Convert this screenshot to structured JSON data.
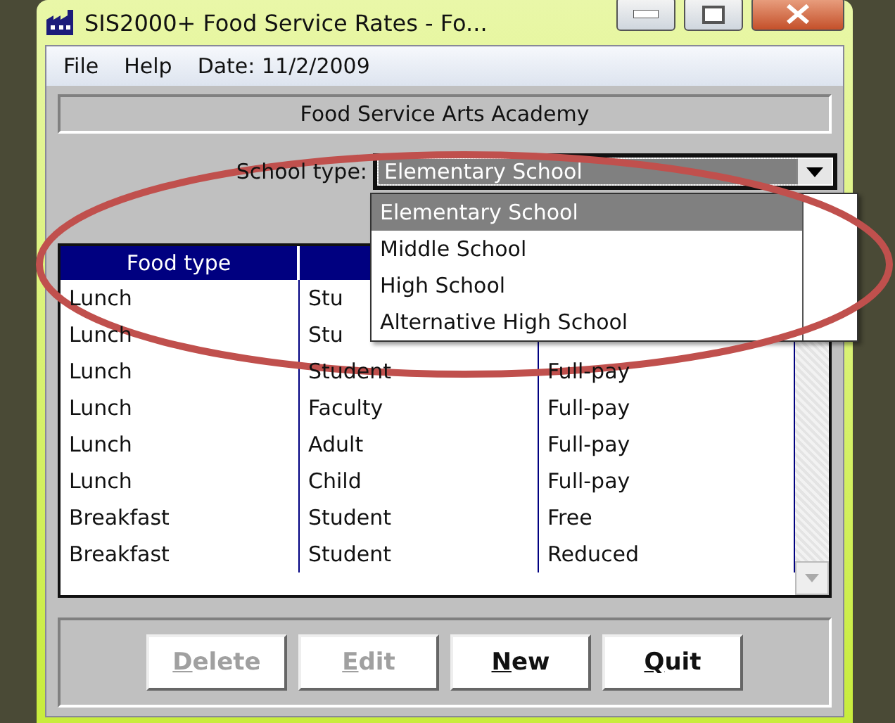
{
  "window": {
    "title": "SIS2000+ Food Service Rates - Fo..."
  },
  "menu": [
    {
      "label": "File"
    },
    {
      "label": "Help"
    }
  ],
  "date": "Date: 11/2/2009",
  "school_name": "Food Service Arts Academy",
  "school_type": {
    "label": "School type:",
    "value": "Elementary School",
    "expanded": true,
    "options": [
      {
        "label": "Elementary School",
        "selected": true
      },
      {
        "label": "Middle School",
        "selected": false
      },
      {
        "label": "High School",
        "selected": false
      },
      {
        "label": "Alternative High School",
        "selected": false
      }
    ]
  },
  "table": {
    "columns": [
      "Food type"
    ],
    "rows": [
      [
        "Lunch",
        "Stu"
      ],
      [
        "Lunch",
        "Stu"
      ],
      [
        "Lunch",
        "Student",
        "Full-pay"
      ],
      [
        "Lunch",
        "Faculty",
        "Full-pay"
      ],
      [
        "Lunch",
        "Adult",
        "Full-pay"
      ],
      [
        "Lunch",
        "Child",
        "Full-pay"
      ],
      [
        "Breakfast",
        "Student",
        "Free"
      ],
      [
        "Breakfast",
        "Student",
        "Reduced"
      ]
    ]
  },
  "buttons": [
    {
      "label": "Delete",
      "disabled": true
    },
    {
      "label": "Edit",
      "disabled": true
    },
    {
      "label": "New",
      "disabled": false
    },
    {
      "label": "Quit",
      "disabled": false
    }
  ],
  "annotation": {
    "kind": "ellipse",
    "color": "#c0504d"
  }
}
